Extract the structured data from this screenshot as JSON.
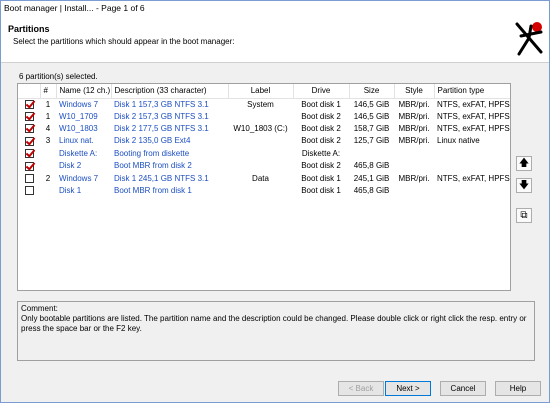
{
  "window": {
    "title": "Boot manager | Install...  -  Page 1 of 6"
  },
  "header": {
    "title": "Partitions",
    "subtitle": "Select the partitions which should appear in the boot manager:"
  },
  "selection": {
    "count_text": "6 partition(s) selected."
  },
  "table": {
    "columns": [
      "#",
      "Name (12 ch.)",
      "Description (33 character)",
      "Label",
      "Drive",
      "Size",
      "Style",
      "Partition type"
    ],
    "rows": [
      {
        "checked": true,
        "num": "1",
        "name": "Windows 7",
        "desc": "Disk 1    157,3 GB    NTFS 3.1",
        "label": "System",
        "drive": "Boot disk 1",
        "size": "146,5 GiB",
        "style": "MBR/pri.",
        "ptype": "NTFS, exFAT, HPFS"
      },
      {
        "checked": true,
        "num": "1",
        "name": "W10_1709",
        "desc": "Disk 2    157,3 GB    NTFS 3.1",
        "label": "",
        "drive": "Boot disk 2",
        "size": "146,5 GiB",
        "style": "MBR/pri.",
        "ptype": "NTFS, exFAT, HPFS"
      },
      {
        "checked": true,
        "num": "4",
        "name": "W10_1803",
        "desc": "Disk 2    177,5 GB    NTFS 3.1",
        "label": "W10_1803 (C:)",
        "drive": "Boot disk 2",
        "size": "158,7 GiB",
        "style": "MBR/pri.",
        "ptype": "NTFS, exFAT, HPFS"
      },
      {
        "checked": true,
        "num": "3",
        "name": "Linux nat.",
        "desc": "Disk 2    135,0 GB        Ext4",
        "label": "",
        "drive": "Boot disk 2",
        "size": "125,7 GiB",
        "style": "MBR/pri.",
        "ptype": "Linux native"
      },
      {
        "checked": true,
        "num": "",
        "name": "Diskette A:",
        "desc": "Booting from diskette",
        "label": "",
        "drive": "Diskette A:",
        "size": "",
        "style": "",
        "ptype": ""
      },
      {
        "checked": true,
        "num": "",
        "name": "Disk 2",
        "desc": "Boot MBR from disk 2",
        "label": "",
        "drive": "Boot disk 2",
        "size": "465,8 GiB",
        "style": "",
        "ptype": ""
      },
      {
        "checked": false,
        "num": "2",
        "name": "Windows 7",
        "desc": "Disk 1    245,1 GB    NTFS 3.1",
        "label": "Data",
        "drive": "Boot disk 1",
        "size": "245,1 GiB",
        "style": "MBR/pri.",
        "ptype": "NTFS, exFAT, HPFS"
      },
      {
        "checked": false,
        "num": "",
        "name": "Disk 1",
        "desc": "Boot MBR from disk 1",
        "label": "",
        "drive": "Boot disk 1",
        "size": "465,8 GiB",
        "style": "",
        "ptype": ""
      }
    ]
  },
  "side_buttons": {
    "up": "🡅",
    "down": "🡇",
    "copy": "⧉"
  },
  "comment": {
    "heading": "Comment:",
    "text": "Only bootable partitions are listed. The partition name and the description could be changed. Please double click or right click the resp. entry or press the space bar or the F2 key."
  },
  "buttons": {
    "back": "< Back",
    "next": "Next >",
    "cancel": "Cancel",
    "help": "Help"
  },
  "colors": {
    "link_blue": "#1c4fc2",
    "check_red": "#c00000"
  }
}
